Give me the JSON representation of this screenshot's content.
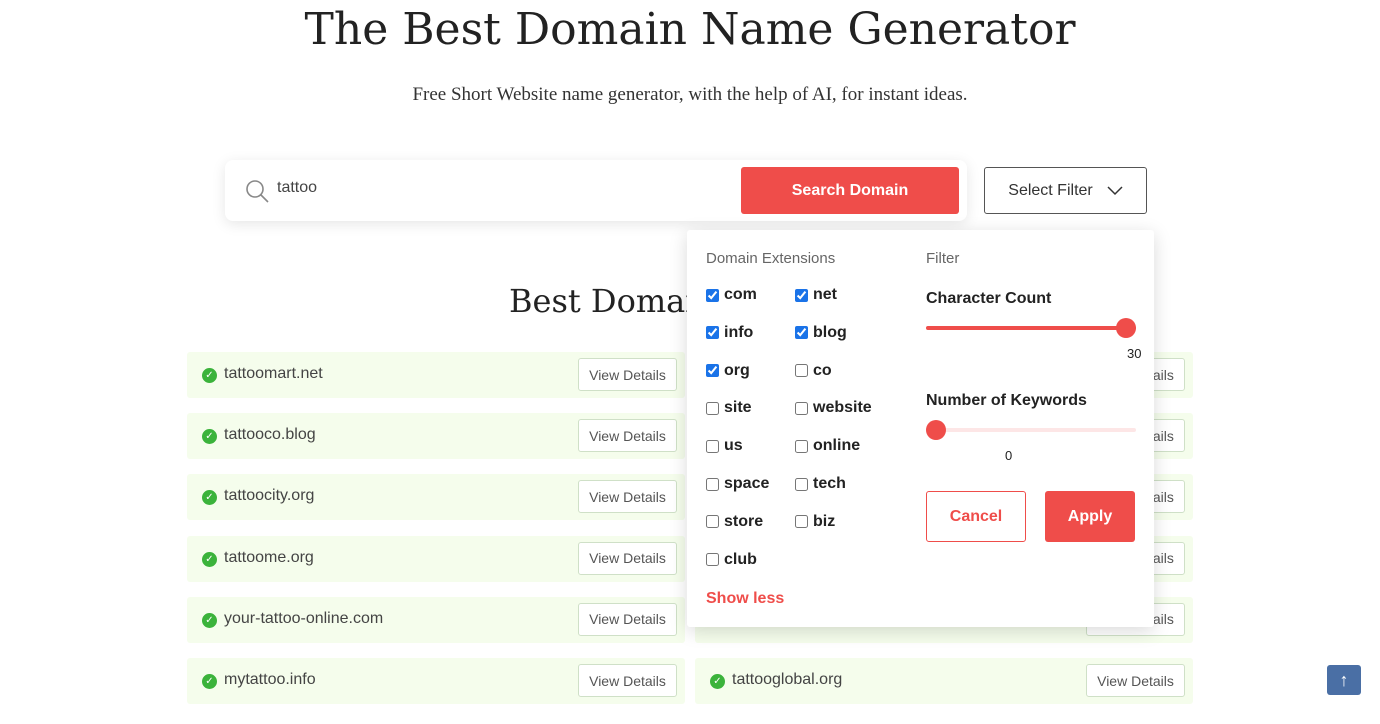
{
  "header": {
    "title": "The Best Domain Name Generator",
    "subtitle": "Free Short Website name generator, with the help of AI, for instant ideas."
  },
  "search": {
    "value": "tattoo",
    "button_label": "Search Domain",
    "filter_label": "Select Filter"
  },
  "results": {
    "title": "Best Domain",
    "left": [
      {
        "name": "tattoomart.net",
        "button": "View Details"
      },
      {
        "name": "tattooco.blog",
        "button": "View Details"
      },
      {
        "name": "tattoocity.org",
        "button": "View Details"
      },
      {
        "name": "tattoome.org",
        "button": "View Details"
      },
      {
        "name": "your-tattoo-online.com",
        "button": "View Details"
      },
      {
        "name": "mytattoo.info",
        "button": "View Details"
      }
    ],
    "right": [
      {
        "name": "",
        "button": "View Details"
      },
      {
        "name": "",
        "button": "View Details"
      },
      {
        "name": "",
        "button": "View Details"
      },
      {
        "name": "",
        "button": "View Details"
      },
      {
        "name": "",
        "button": "View Details"
      },
      {
        "name": "tattooglobal.org",
        "button": "View Details"
      }
    ]
  },
  "filter_popup": {
    "extensions_label": "Domain Extensions",
    "filter_label": "Filter",
    "extensions": [
      {
        "label": "com",
        "checked": true
      },
      {
        "label": "net",
        "checked": true
      },
      {
        "label": "info",
        "checked": true
      },
      {
        "label": "blog",
        "checked": true
      },
      {
        "label": "org",
        "checked": true
      },
      {
        "label": "co",
        "checked": false
      },
      {
        "label": "site",
        "checked": false
      },
      {
        "label": "website",
        "checked": false
      },
      {
        "label": "us",
        "checked": false
      },
      {
        "label": "online",
        "checked": false
      },
      {
        "label": "space",
        "checked": false
      },
      {
        "label": "tech",
        "checked": false
      },
      {
        "label": "store",
        "checked": false
      },
      {
        "label": "biz",
        "checked": false
      },
      {
        "label": "club",
        "checked": false
      }
    ],
    "show_less": "Show less",
    "character_count": {
      "label": "Character Count",
      "value": "30",
      "fraction": 1.0
    },
    "keywords": {
      "label": "Number of Keywords",
      "value": "0",
      "fraction": 0.0
    },
    "cancel": "Cancel",
    "apply": "Apply"
  },
  "colors": {
    "accent": "#ef4d4a",
    "row_bg": "#f5fdec",
    "success": "#3bb33b",
    "scroll_top": "#4a6fa5"
  },
  "scroll_top_icon": "arrow-up-icon"
}
